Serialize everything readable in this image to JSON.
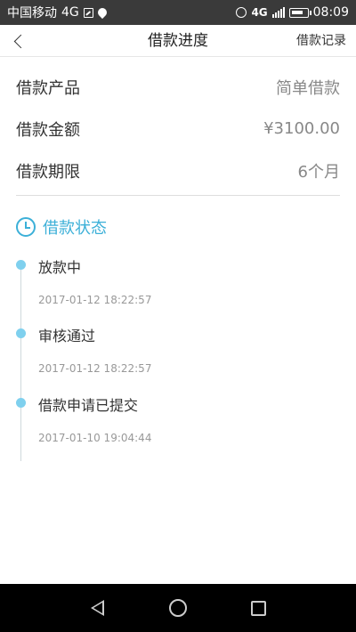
{
  "status_bar": {
    "carrier": "中国移动",
    "network": "4G",
    "network_small": "4G",
    "time": "08:09",
    "icons": [
      "image-icon",
      "location-pin-icon",
      "alarm-icon",
      "signal-icon",
      "battery-icon"
    ]
  },
  "header": {
    "title": "借款进度",
    "records_label": "借款记录",
    "back_icon": "chevron-left-icon"
  },
  "info": [
    {
      "label": "借款产品",
      "value": "简单借款"
    },
    {
      "label": "借款金额",
      "value": "¥3100.00"
    },
    {
      "label": "借款期限",
      "value": "6个月"
    }
  ],
  "status_section": {
    "title": "借款状态",
    "icon": "clock-icon",
    "accent_color": "#3cb0d8",
    "steps": [
      {
        "title": "放款中",
        "time": "2017-01-12 18:22:57"
      },
      {
        "title": "审核通过",
        "time": "2017-01-12 18:22:57"
      },
      {
        "title": "借款申请已提交",
        "time": "2017-01-10 19:04:44"
      }
    ]
  },
  "nav_bar": {
    "icons": [
      "nav-back-icon",
      "nav-home-icon",
      "nav-recent-icon"
    ]
  }
}
